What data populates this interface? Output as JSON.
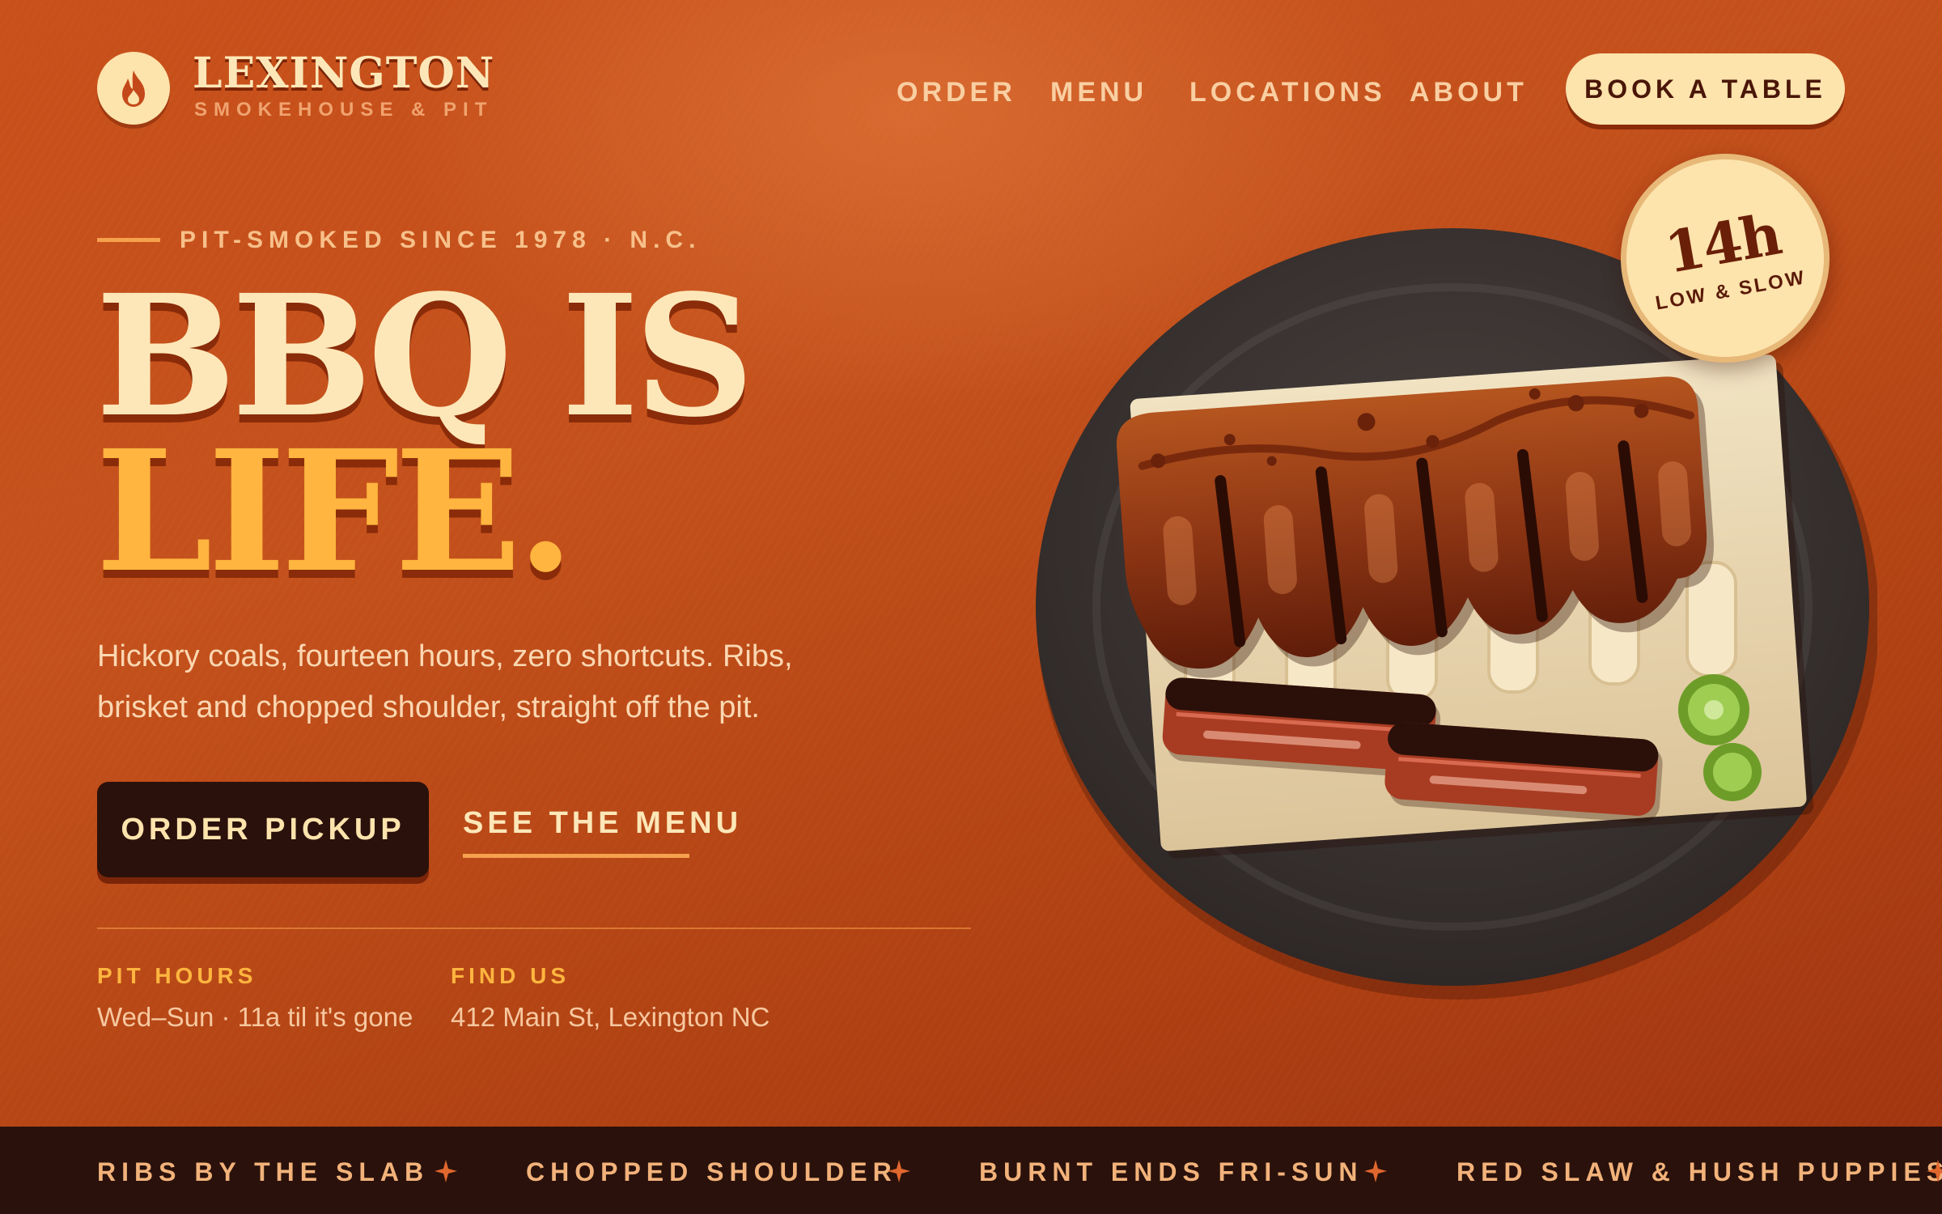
{
  "brand": {
    "name": "LEXINGTON",
    "subtitle": "SMOKEHOUSE & PIT",
    "logo_icon": "flame-icon"
  },
  "nav": {
    "items": [
      "ORDER",
      "MENU",
      "LOCATIONS",
      "ABOUT"
    ],
    "cta": "BOOK A TABLE"
  },
  "hero": {
    "eyebrow": "PIT-SMOKED SINCE 1978 · N.C.",
    "headline_line1": "BBQ IS",
    "headline_line2": "LIFE.",
    "lede": "Hickory coals, fourteen hours, zero shortcuts. Ribs, brisket and chopped shoulder, straight off the pit.",
    "primary_cta": "ORDER PICKUP",
    "secondary_cta": "SEE THE MENU"
  },
  "info": {
    "hours_label": "PIT HOURS",
    "hours_value": "Wed–Sun · 11a til it's gone",
    "location_label": "FIND US",
    "location_value": "412 Main St, Lexington NC"
  },
  "badge": {
    "value": "14h",
    "label": "LOW & SLOW"
  },
  "ticker": {
    "items": [
      "RIBS BY THE SLAB",
      "CHOPPED SHOULDER",
      "BURNT ENDS FRI-SUN",
      "RED SLAW & HUSH PUPPIES"
    ],
    "separator_icon": "star-icon"
  },
  "colors": {
    "background": "#c4511c",
    "cream": "#fde7b8",
    "accent": "#ffb53f",
    "dark": "#2a110b",
    "plate": "#3a3332"
  }
}
